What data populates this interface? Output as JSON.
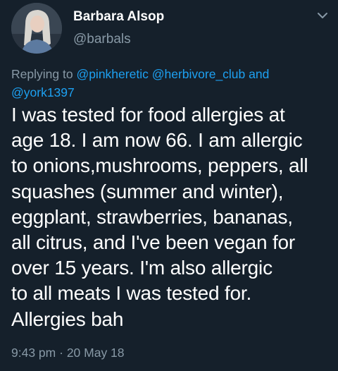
{
  "author": {
    "display_name": "Barbara Alsop",
    "handle": "@barbals",
    "avatar_icon": "user-photo-avatar"
  },
  "reply": {
    "prefix": "Replying to",
    "mentions": [
      "@pinkheretic",
      "@herbivore_club",
      "@york1397"
    ],
    "conjunction": "and"
  },
  "tweet": {
    "text": "I was tested for food allergies at\nage 18. I am now 66. I am allergic\nto onions,mushrooms, peppers, all\nsquashes (summer and winter),\neggplant, strawberries, bananas,\nall citrus, and I've been vegan for\nover 15 years. I'm also allergic\nto all meats I was tested for.\nAllergies bah",
    "time": "9:43 pm",
    "separator": "·",
    "date": "20 May 18"
  },
  "menu_icon": "chevron-down-icon",
  "colors": {
    "background": "#15202b",
    "primary_text": "#ffffff",
    "secondary_text": "#8899a6",
    "link": "#1da1f2"
  }
}
